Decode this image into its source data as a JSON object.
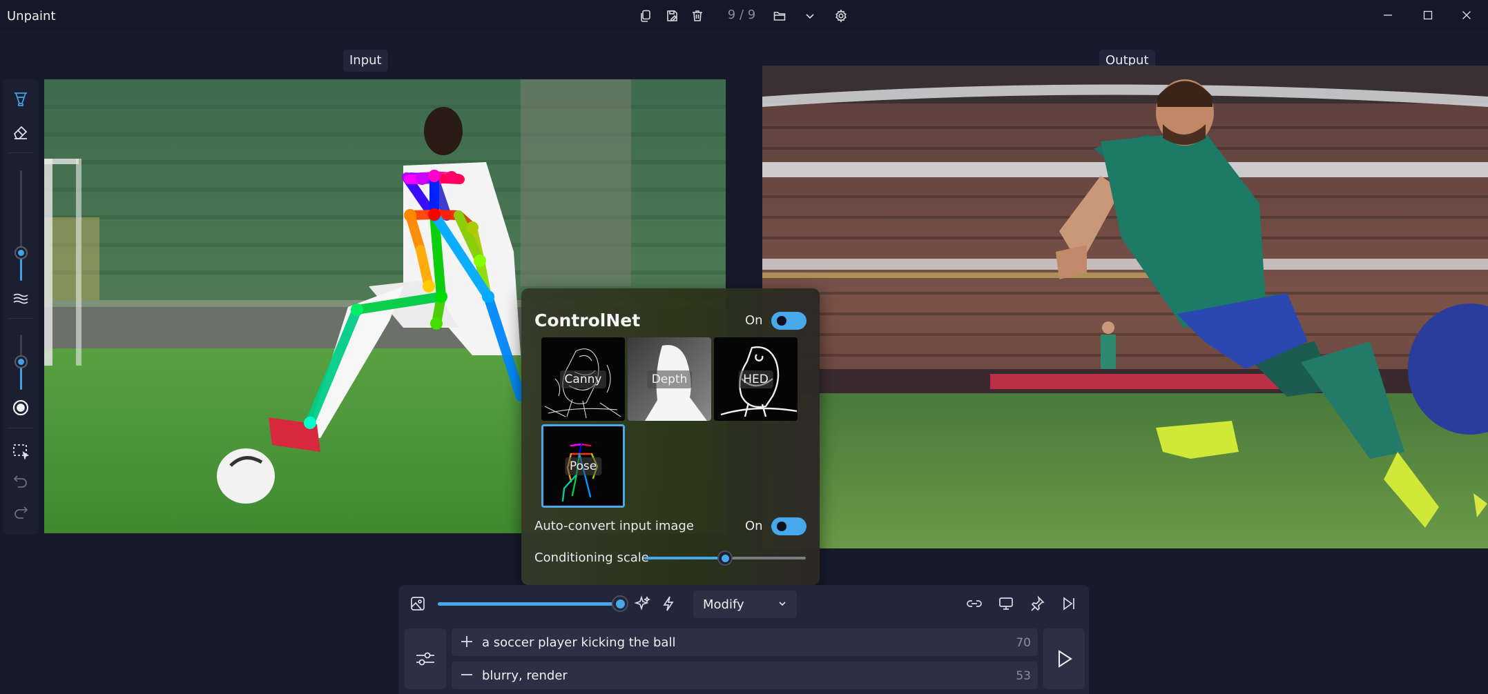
{
  "window": {
    "title": "Unpaint",
    "counter": "9 / 9"
  },
  "labels": {
    "input": "Input",
    "output": "Output"
  },
  "controlnet": {
    "title": "ControlNet",
    "enabled_label": "On",
    "enabled": true,
    "modes": [
      {
        "label": "Canny",
        "selected": false
      },
      {
        "label": "Depth",
        "selected": false
      },
      {
        "label": "HED",
        "selected": false
      },
      {
        "label": "Pose",
        "selected": true
      }
    ],
    "auto_convert": {
      "label": "Auto-convert input image",
      "state_label": "On",
      "enabled": true
    },
    "conditioning_scale": {
      "label": "Conditioning scale",
      "value": 0.5
    }
  },
  "toolbar": {
    "brush_size": 0.25,
    "brush_opacity": 0.5
  },
  "bottom": {
    "strength": 1.0,
    "mode": {
      "value": "Modify"
    },
    "positive_prompt": {
      "text": "a soccer player kicking the ball",
      "count": "70"
    },
    "negative_prompt": {
      "text": "blurry, render",
      "count": "53"
    }
  },
  "colors": {
    "accent": "#48a8ec",
    "background": "#161a2b",
    "panel": "#22263a"
  }
}
